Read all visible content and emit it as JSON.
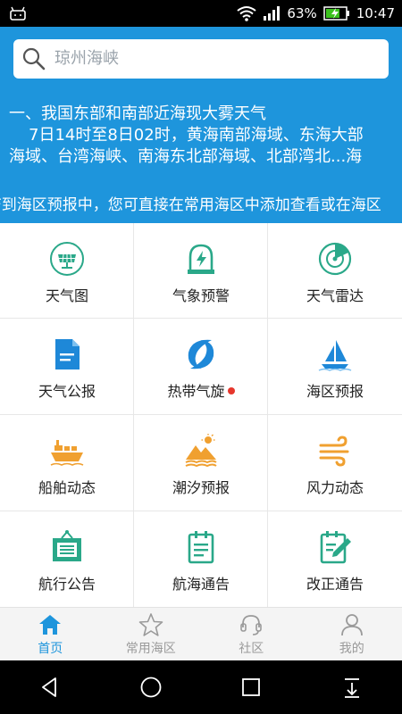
{
  "status_bar": {
    "battery": "63%",
    "time": "10:47"
  },
  "search": {
    "placeholder": "琼州海峡"
  },
  "notice": {
    "line1": "一、我国东部和南部近海现大雾天气",
    "line2": "7日14时至8日02时，黄海南部海域、东海大部",
    "line3": "海域、台湾海峡、南海东北部海域、北部湾北...海",
    "marquee": "F到海区预报中，您可直接在常用海区中添加查看或在海区"
  },
  "grid": [
    {
      "label": "天气图",
      "icon": "weather-map-icon"
    },
    {
      "label": "气象预警",
      "icon": "weather-warning-icon"
    },
    {
      "label": "天气雷达",
      "icon": "weather-radar-icon"
    },
    {
      "label": "天气公报",
      "icon": "weather-bulletin-icon"
    },
    {
      "label": "热带气旋",
      "icon": "typhoon-icon",
      "badge": true
    },
    {
      "label": "海区预报",
      "icon": "sailboat-icon"
    },
    {
      "label": "船舶动态",
      "icon": "ship-icon"
    },
    {
      "label": "潮汐预报",
      "icon": "tide-icon"
    },
    {
      "label": "风力动态",
      "icon": "wind-icon"
    },
    {
      "label": "航行公告",
      "icon": "navigation-notice-icon"
    },
    {
      "label": "航海通告",
      "icon": "nautical-notice-icon"
    },
    {
      "label": "改正通告",
      "icon": "correction-notice-icon"
    }
  ],
  "tabs": [
    {
      "label": "首页",
      "icon": "home-icon",
      "active": true
    },
    {
      "label": "常用海区",
      "icon": "star-icon"
    },
    {
      "label": "社区",
      "icon": "headset-icon"
    },
    {
      "label": "我的",
      "icon": "user-icon"
    }
  ],
  "colors": {
    "brand": "#1e95dc",
    "teal": "#2aa889",
    "orange": "#f0a030",
    "blue": "#1e88d8",
    "badge": "#e6362c"
  }
}
